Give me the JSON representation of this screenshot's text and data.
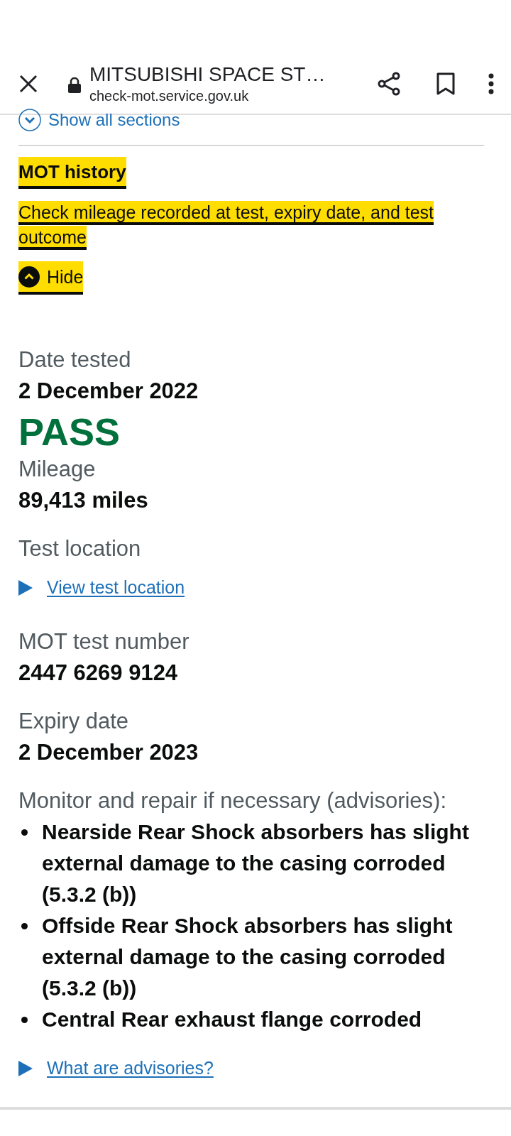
{
  "browser": {
    "title": "MITSUBISHI SPACE ST…",
    "url": "check-mot.service.gov.uk"
  },
  "show_all": {
    "label": "Show all sections",
    "expanded": false
  },
  "section": {
    "title": "MOT history",
    "summary": "Check mileage recorded at test, expiry date, and test outcome",
    "toggle": {
      "label": "Hide",
      "expanded": true
    }
  },
  "test": [
    {
      "kind": "field",
      "label": "Date tested",
      "value": "2 December 2022"
    },
    {
      "kind": "result",
      "value": "PASS",
      "passed": true
    },
    {
      "kind": "field",
      "label": "Mileage",
      "value": "89,413 miles"
    },
    {
      "kind": "label",
      "label": "Test location"
    },
    {
      "kind": "details",
      "link": "View test location",
      "expanded": false
    },
    {
      "kind": "field",
      "label": "MOT test number",
      "value": "2447 6269 9124"
    },
    {
      "kind": "field",
      "label": "Expiry date",
      "value": "2 December 2023"
    },
    {
      "kind": "list",
      "label": "Monitor and repair if necessary (advisories):",
      "items": [
        "Nearside Rear Shock absorbers has slight external damage to the casing corroded (5.3.2 (b))",
        "Offside Rear Shock absorbers has slight external damage to the casing corroded (5.3.2 (b))",
        "Central Rear exhaust flange corroded"
      ]
    },
    {
      "kind": "details",
      "link": "What are advisories?",
      "expanded": false
    }
  ]
}
